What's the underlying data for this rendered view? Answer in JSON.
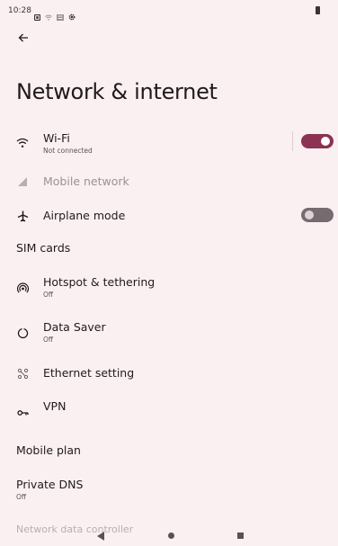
{
  "status_bar": {
    "time": "10:28"
  },
  "header": {
    "title": "Network & internet"
  },
  "items": {
    "wifi": {
      "title": "Wi-Fi",
      "summary": "Not connected",
      "toggle": "on"
    },
    "mobile_network": {
      "title": "Mobile network",
      "state": "disabled"
    },
    "airplane": {
      "title": "Airplane mode",
      "toggle": "off"
    },
    "sim_cards": {
      "title": "SIM cards"
    },
    "hotspot": {
      "title": "Hotspot & tethering",
      "summary": "Off"
    },
    "data_saver": {
      "title": "Data Saver",
      "summary": "Off"
    },
    "ethernet": {
      "title": "Ethernet setting"
    },
    "vpn": {
      "title": "VPN"
    },
    "mobile_plan": {
      "title": "Mobile plan"
    },
    "private_dns": {
      "title": "Private DNS",
      "summary": "Off"
    },
    "network_data_controller": {
      "title": "Network data controller"
    }
  },
  "colors": {
    "accent": "#8c3252",
    "background": "#fbf0f1",
    "switch_off": "#766b6f"
  }
}
